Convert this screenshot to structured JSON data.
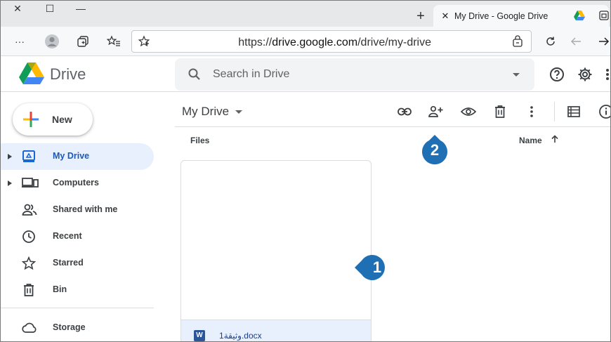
{
  "browser": {
    "window_controls": {
      "close": "✕",
      "maximize": "☐",
      "minimize": "—"
    },
    "new_tab_glyph": "+",
    "tab": {
      "close_glyph": "✕",
      "title": "My Drive - Google Drive"
    },
    "address": {
      "url_prefix": "https://",
      "url_host": "drive.google.com",
      "url_path": "/drive/my-drive",
      "more_glyph": "···"
    }
  },
  "drive": {
    "brand": "Drive",
    "search_placeholder": "Search in Drive",
    "new_button": "New",
    "nav": [
      {
        "label": "My Drive",
        "icon": "my-drive-icon",
        "active": true,
        "expandable": true
      },
      {
        "label": "Computers",
        "icon": "computers-icon",
        "active": false,
        "expandable": true
      },
      {
        "label": "Shared with me",
        "icon": "shared-icon",
        "active": false,
        "expandable": false
      },
      {
        "label": "Recent",
        "icon": "clock-icon",
        "active": false,
        "expandable": false
      },
      {
        "label": "Starred",
        "icon": "star-icon",
        "active": false,
        "expandable": false
      },
      {
        "label": "Bin",
        "icon": "trash-icon",
        "active": false,
        "expandable": false
      }
    ],
    "storage_label": "Storage",
    "main": {
      "title": "My Drive",
      "files_label": "Files",
      "sort_label": "Name",
      "file": {
        "name": "وثيقة1.docx",
        "type_glyph": "W"
      }
    }
  },
  "callouts": [
    {
      "number": "1",
      "color": "#1f6fb5"
    },
    {
      "number": "2",
      "color": "#1f6fb5"
    }
  ],
  "colors": {
    "accent_blue": "#1a73e8",
    "active_bg": "#e8f0fe",
    "callout": "#1f6fb5"
  }
}
